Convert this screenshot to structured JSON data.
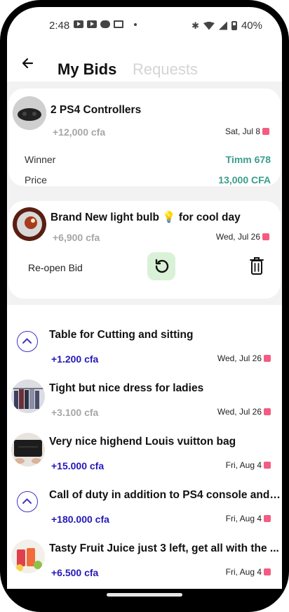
{
  "status_bar": {
    "time": "2:48",
    "battery": "40%"
  },
  "header": {
    "tab_active": "My Bids",
    "tab_inactive": "Requests"
  },
  "won_bid": {
    "title": "2 PS4 Controllers",
    "amount": "+12,000 cfa",
    "date": "Sat, Jul 8",
    "winner_label": "Winner",
    "winner_value": "Timm 678",
    "price_label": "Price",
    "price_value": "13,000 CFA"
  },
  "closed_bid": {
    "title": "Brand New light bulb 💡 for cool day",
    "amount": "+6,900 cfa",
    "date": "Wed, Jul 26",
    "reopen_label": "Re-open Bid"
  },
  "bids": [
    {
      "title": "Table for Cutting and sitting",
      "amount": "+1.200 cfa",
      "amount_style": "blue",
      "date": "Wed, Jul 26",
      "thumb": "chevron"
    },
    {
      "title": "Tight but nice dress for ladies",
      "amount": "+3.100 cfa",
      "amount_style": "gray",
      "date": "Wed, Jul 26",
      "thumb": "dress"
    },
    {
      "title": "Very nice highend Louis vuitton bag",
      "amount": "+15.000 cfa",
      "amount_style": "blue",
      "date": "Fri, Aug 4",
      "thumb": "bag"
    },
    {
      "title": "Call of duty in addition to PS4 console and ...",
      "amount": "+180.000 cfa",
      "amount_style": "blue",
      "date": "Fri, Aug 4",
      "thumb": "chevron"
    },
    {
      "title": "Tasty Fruit Juice just 3 left, get all with the ...",
      "amount": "+6.500 cfa",
      "amount_style": "blue",
      "date": "Fri, Aug 4",
      "thumb": "juice"
    }
  ],
  "colors": {
    "accent_blue": "#2418b8",
    "teal": "#3a9d8c",
    "flag_pink": "#f45b82",
    "reload_bg": "#d9f2d7"
  }
}
